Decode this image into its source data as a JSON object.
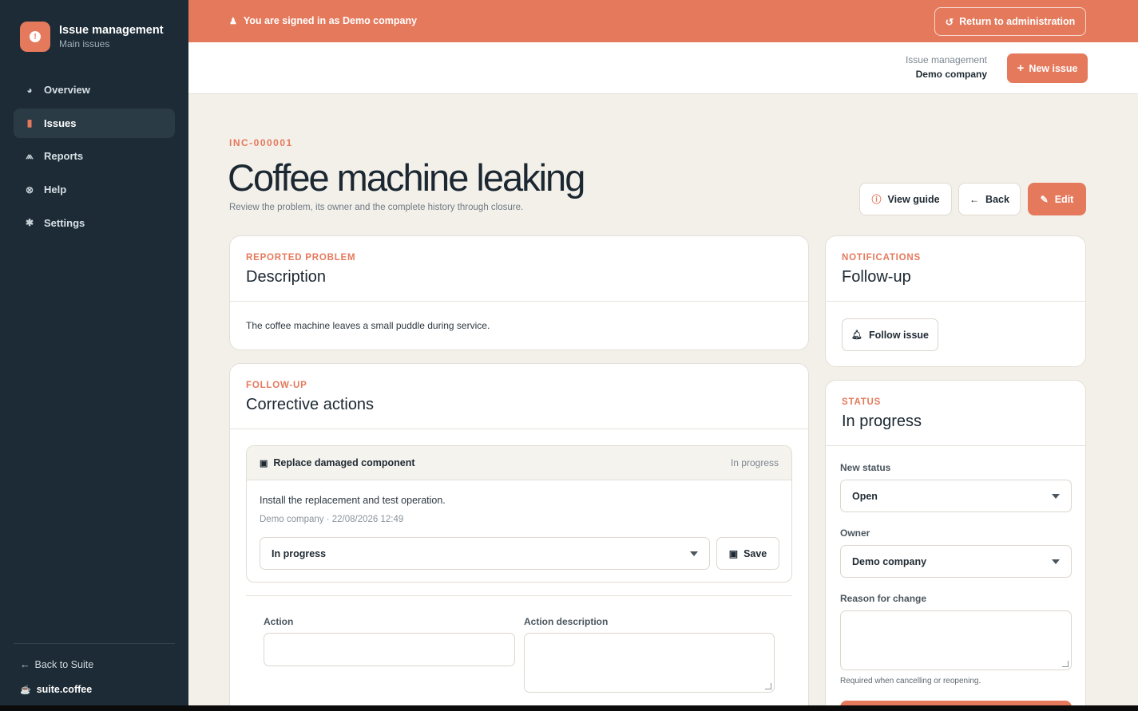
{
  "sidebar": {
    "brand_title": "Issue management",
    "brand_subtitle": "Main issues",
    "items": [
      {
        "label": "Overview",
        "icon": "pie-chart-icon"
      },
      {
        "label": "Issues",
        "icon": "clipboard-icon"
      },
      {
        "label": "Reports",
        "icon": "bar-chart-icon"
      },
      {
        "label": "Help",
        "icon": "life-ring-icon"
      },
      {
        "label": "Settings",
        "icon": "gear-icon"
      }
    ],
    "active_item": "Issues",
    "back_label": "Back to Suite",
    "suite_label": "suite.coffee"
  },
  "banner": {
    "signed_in_text": "You are signed in as Demo company",
    "return_label": "Return to administration"
  },
  "topbar": {
    "module_label": "Issue management",
    "company_name": "Demo company",
    "new_issue_label": "New issue"
  },
  "issue": {
    "code": "INC-000001",
    "title": "Coffee machine leaking",
    "subtitle": "Review the problem, its owner and the complete history through closure.",
    "view_guide_label": "View guide",
    "back_label": "Back",
    "edit_label": "Edit"
  },
  "description_card": {
    "eyebrow": "REPORTED PROBLEM",
    "title": "Description",
    "body": "The coffee machine leaves a small puddle during service."
  },
  "actions_card": {
    "eyebrow": "FOLLOW-UP",
    "title": "Corrective actions",
    "action": {
      "title": "Replace damaged component",
      "status": "In progress",
      "description": "Install the replacement and test operation.",
      "meta": "Demo company · 22/08/2026 12:49",
      "selected_status": "In progress",
      "save_label": "Save"
    },
    "new_action_label": "Action",
    "new_action_description_label": "Action description"
  },
  "notifications_card": {
    "eyebrow": "NOTIFICATIONS",
    "title": "Follow-up",
    "follow_label": "Follow issue"
  },
  "status_card": {
    "eyebrow": "STATUS",
    "title": "In progress",
    "new_status_label": "New status",
    "new_status_value": "Open",
    "owner_label": "Owner",
    "owner_value": "Demo company",
    "reason_label": "Reason for change",
    "hint": "Required when cancelling or reopening."
  },
  "colors": {
    "accent": "#e5795c",
    "sidebar_bg": "#1c2b36",
    "page_bg": "#f3f0ea"
  }
}
